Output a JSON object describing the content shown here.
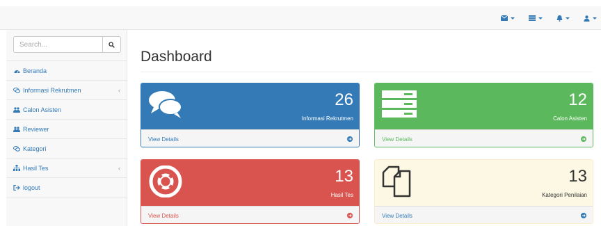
{
  "colors": {
    "primary": "#337ab7",
    "green": "#5cb85c",
    "red": "#d9534f",
    "yellow_bg": "#fcf8e3"
  },
  "topbar": {
    "icons": [
      "envelope-icon",
      "tasks-icon",
      "bell-icon",
      "user-icon"
    ]
  },
  "search": {
    "placeholder": "Search..."
  },
  "sidebar": {
    "items": [
      {
        "label": "Beranda",
        "icon": "dashboard-icon"
      },
      {
        "label": "Informasi Rekrutmen",
        "icon": "comments-icon",
        "has_submenu": true
      },
      {
        "label": "Calon Asisten",
        "icon": "users-icon"
      },
      {
        "label": "Reviewer",
        "icon": "users-icon"
      },
      {
        "label": "Kategori",
        "icon": "comments-icon"
      },
      {
        "label": "Hasil Tes",
        "icon": "sitemap-icon",
        "has_submenu": true
      },
      {
        "label": "logout",
        "icon": "sign-out-icon"
      }
    ]
  },
  "page": {
    "title": "Dashboard"
  },
  "panels": [
    {
      "count": "26",
      "label": "Informasi Rekrutmen",
      "link": "View Details",
      "icon": "comments-icon"
    },
    {
      "count": "12",
      "label": "Calon Asisten",
      "link": "View Details",
      "icon": "server-icon"
    },
    {
      "count": "13",
      "label": "Hasil Tes",
      "link": "View Details",
      "icon": "life-ring-icon"
    },
    {
      "count": "13",
      "label": "Kategori Penilaian",
      "link": "View Details",
      "icon": "files-icon"
    }
  ]
}
